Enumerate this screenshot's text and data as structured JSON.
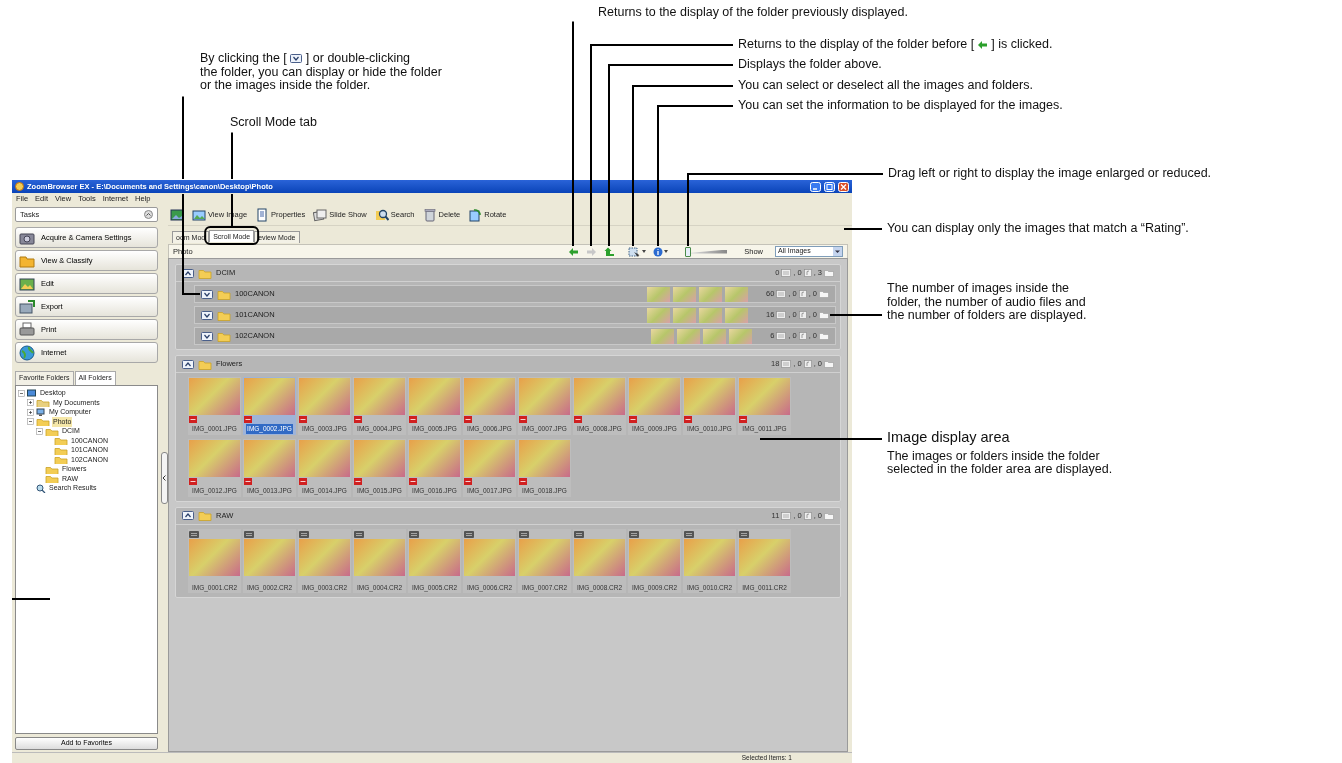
{
  "callouts": [
    {
      "kind": "with_expand_icon",
      "before": "By clicking the [",
      "after": "] or double-clicking",
      "continuation": "the folder, you can display or hide the folder or the images inside the folder."
    },
    {
      "kind": "plain",
      "text": "Scroll Mode tab"
    },
    {
      "kind": "plain",
      "text": "Returns to the display of the folder previously displayed."
    },
    {
      "kind": "with_back_icon",
      "before": "Returns to the display of the folder before [",
      "after": "] is clicked."
    },
    {
      "kind": "plain",
      "text": "Displays the folder above."
    },
    {
      "kind": "plain",
      "text": "You can select or deselect all the images and folders."
    },
    {
      "kind": "plain",
      "text": "You can set the information to be displayed for the images."
    },
    {
      "kind": "plain",
      "text": "Drag left or right to display the image enlarged or reduced."
    },
    {
      "kind": "plain",
      "text": "You can display only the images that match a “Rating”."
    },
    {
      "kind": "plain",
      "text": "The number of images inside the folder, the number of audio files and the number of folders are displayed."
    },
    {
      "kind": "heading",
      "title": "Image display area",
      "text": "The images or folders inside the folder selected in the folder area are displayed."
    }
  ],
  "window": {
    "title": "ZoomBrowser EX - E:\\Documents and Settings\\canon\\Desktop\\Photo",
    "menu": [
      "File",
      "Edit",
      "View",
      "Tools",
      "Internet",
      "Help"
    ],
    "tasks": {
      "title": "Tasks",
      "items": [
        "Acquire & Camera Settings",
        "View & Classify",
        "Edit",
        "Export",
        "Print",
        "Internet"
      ]
    },
    "folder_tabs": [
      {
        "label": "Favorite Folders",
        "selected": false
      },
      {
        "label": "All Folders",
        "selected": true
      }
    ],
    "tree": [
      {
        "label": "Desktop",
        "kind": "desktop",
        "expanded": true,
        "children": [
          {
            "label": "My Documents",
            "kind": "documents",
            "expanded": false
          },
          {
            "label": "My Computer",
            "kind": "computer",
            "expanded": false
          },
          {
            "label": "Photo",
            "kind": "folder",
            "expanded": true,
            "selected": true,
            "children": [
              {
                "label": "DCIM",
                "kind": "folder",
                "expanded": true,
                "children": [
                  {
                    "label": "100CANON",
                    "kind": "folder"
                  },
                  {
                    "label": "101CANON",
                    "kind": "folder"
                  },
                  {
                    "label": "102CANON",
                    "kind": "folder"
                  }
                ]
              },
              {
                "label": "Flowers",
                "kind": "folder"
              },
              {
                "label": "RAW",
                "kind": "folder"
              }
            ]
          },
          {
            "label": "Search Results",
            "kind": "search"
          }
        ]
      }
    ],
    "add_button": "Add to Favorites",
    "toolbar": [
      "View Image",
      "Properties",
      "Slide Show",
      "Search",
      "Delete",
      "Rotate"
    ],
    "mode_tabs": [
      {
        "label": "oom Mod",
        "selected": false
      },
      {
        "label": "Scroll Mode",
        "selected": true
      },
      {
        "label": "eview Mode",
        "selected": false
      }
    ],
    "path": "Photo",
    "nav": [
      {
        "kind": "back",
        "disabled": false
      },
      {
        "kind": "forward",
        "disabled": true
      },
      {
        "kind": "up",
        "disabled": false
      },
      {
        "kind": "select",
        "disabled": false
      },
      {
        "kind": "info",
        "disabled": false
      }
    ],
    "zoom_slider": {
      "level": 0.05
    },
    "show": {
      "label": "Show",
      "value": "All Images"
    },
    "groups": [
      {
        "name": "DCIM",
        "expanded": true,
        "images": "0",
        "audio": ", 0",
        "folders": ", 3",
        "subfolders": [
          {
            "name": "100CANON",
            "expanded": false,
            "previews": [
              {
                "kind": "photo"
              },
              {
                "kind": "photo"
              },
              {
                "kind": "photo"
              },
              {
                "kind": "photo"
              }
            ],
            "images": "60",
            "audio": ", 0",
            "folders": ", 0"
          },
          {
            "name": "101CANON",
            "expanded": false,
            "previews": [
              {
                "kind": "photo"
              },
              {
                "kind": "photo"
              },
              {
                "kind": "photo"
              },
              {
                "kind": "photo"
              }
            ],
            "images": "16",
            "audio": ", 0",
            "folders": ", 0"
          },
          {
            "name": "102CANON",
            "expanded": false,
            "previews": [
              {
                "kind": "photo"
              },
              {
                "kind": "photo"
              },
              {
                "kind": "photo"
              },
              {
                "kind": "photo"
              }
            ],
            "images": "6",
            "audio": ", 0",
            "folders": ", 0"
          }
        ]
      },
      {
        "name": "Flowers",
        "expanded": true,
        "kind": "jpeg",
        "images": "18",
        "audio": ", 0",
        "folders": ", 0",
        "files": [
          {
            "name": "IMG_0001.JPG",
            "selected": false
          },
          {
            "name": "IMG_0002.JPG",
            "selected": true
          },
          {
            "name": "IMG_0003.JPG",
            "selected": false
          },
          {
            "name": "IMG_0004.JPG",
            "selected": false
          },
          {
            "name": "IMG_0005.JPG",
            "selected": false
          },
          {
            "name": "IMG_0006.JPG",
            "selected": false
          },
          {
            "name": "IMG_0007.JPG",
            "selected": false
          },
          {
            "name": "IMG_0008.JPG",
            "selected": false
          },
          {
            "name": "IMG_0009.JPG",
            "selected": false
          },
          {
            "name": "IMG_0010.JPG",
            "selected": false
          },
          {
            "name": "IMG_0011.JPG",
            "selected": false
          },
          {
            "name": "IMG_0012.JPG",
            "selected": false
          },
          {
            "name": "IMG_0013.JPG",
            "selected": false
          },
          {
            "name": "IMG_0014.JPG",
            "selected": false
          },
          {
            "name": "IMG_0015.JPG",
            "selected": false
          },
          {
            "name": "IMG_0016.JPG",
            "selected": false
          },
          {
            "name": "IMG_0017.JPG",
            "selected": false
          },
          {
            "name": "IMG_0018.JPG",
            "selected": false
          }
        ]
      },
      {
        "name": "RAW",
        "expanded": true,
        "kind": "raw",
        "images": "11",
        "audio": ", 0",
        "folders": ", 0",
        "files": [
          {
            "name": "IMG_0001.CR2",
            "selected": false
          },
          {
            "name": "IMG_0002.CR2",
            "selected": false
          },
          {
            "name": "IMG_0003.CR2",
            "selected": false
          },
          {
            "name": "IMG_0004.CR2",
            "selected": false
          },
          {
            "name": "IMG_0005.CR2",
            "selected": false
          },
          {
            "name": "IMG_0006.CR2",
            "selected": false
          },
          {
            "name": "IMG_0007.CR2",
            "selected": false
          },
          {
            "name": "IMG_0008.CR2",
            "selected": false
          },
          {
            "name": "IMG_0009.CR2",
            "selected": false
          },
          {
            "name": "IMG_0010.CR2",
            "selected": false
          },
          {
            "name": "IMG_0011.CR2",
            "selected": false
          }
        ]
      }
    ],
    "status": "Selected Items: 1"
  }
}
